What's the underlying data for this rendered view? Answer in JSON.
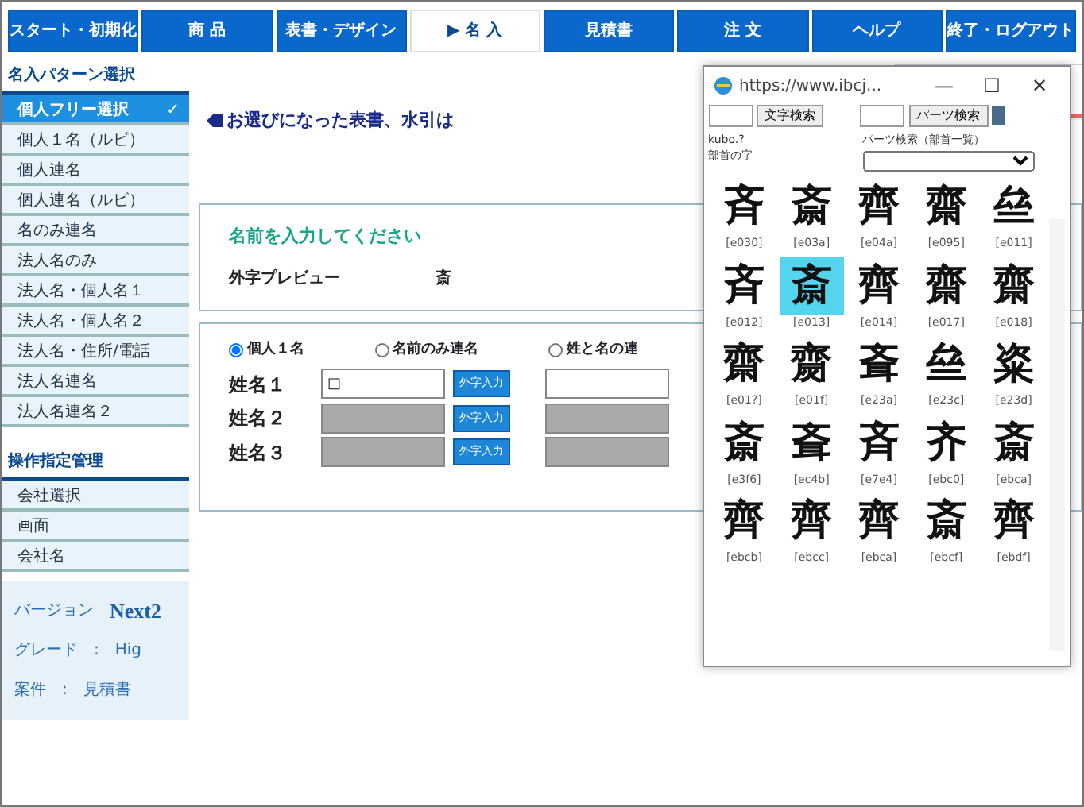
{
  "nav": [
    {
      "label": "スタート・初期化",
      "selected": false
    },
    {
      "label": "商 品",
      "selected": false
    },
    {
      "label": "表書・デザイン",
      "selected": false
    },
    {
      "label": "▶ 名 入",
      "selected": true
    },
    {
      "label": "見積書",
      "selected": false
    },
    {
      "label": "注 文",
      "selected": false
    },
    {
      "label": "ヘルプ",
      "selected": false
    },
    {
      "label": "終了・ログアウト",
      "selected": false
    }
  ],
  "sidebar": {
    "title": "名入パターン選択",
    "items": [
      {
        "label": "個人フリー選択",
        "selected": true,
        "check": "✓"
      },
      {
        "label": "個人１名（ルビ）",
        "selected": false
      },
      {
        "label": "個人連名",
        "selected": false
      },
      {
        "label": "個人連名（ルビ）",
        "selected": false
      },
      {
        "label": "名のみ連名",
        "selected": false
      },
      {
        "label": "法人名のみ",
        "selected": false
      },
      {
        "label": "法人名・個人名１",
        "selected": false
      },
      {
        "label": "法人名・個人名２",
        "selected": false
      },
      {
        "label": "法人名・住所/電話",
        "selected": false
      },
      {
        "label": "法人名連名",
        "selected": false
      },
      {
        "label": "法人名連名２",
        "selected": false
      }
    ],
    "section_title": "操作指定管理",
    "section_items": [
      {
        "label": "会社選択"
      },
      {
        "label": "画面"
      },
      {
        "label": "会社名"
      }
    ],
    "info": [
      {
        "label": "バージョン",
        "value": "Next2",
        "kind": "version"
      },
      {
        "label": "グレード",
        "sep": ":",
        "value": "Hig",
        "kind": "plain"
      },
      {
        "label": "案件",
        "sep": ":",
        "value": "見積書",
        "kind": "plain"
      }
    ]
  },
  "selection": {
    "heading": "お選びになった表書、水引は"
  },
  "name_card": {
    "title": "名前を入力してください",
    "preview_label": "外字プレビュー",
    "preview_char": "斎"
  },
  "entry": {
    "modes": [
      {
        "label": "個人１名",
        "selected": true
      },
      {
        "label": "名前のみ連名",
        "selected": false
      },
      {
        "label": "姓と名の連",
        "selected": false
      }
    ],
    "rows": [
      {
        "label": "姓名１",
        "value": "□",
        "disabled": false,
        "button": "外字入力"
      },
      {
        "label": "姓名２",
        "value": "",
        "disabled": true,
        "button": "外字入力"
      },
      {
        "label": "姓名３",
        "value": "",
        "disabled": true,
        "button": "外字入力"
      }
    ]
  },
  "popup": {
    "title": "https://www.ibcj...",
    "controls": [
      "—",
      "☐",
      "✕"
    ],
    "search_button": "文字検索",
    "parts_button": "パーツ検索",
    "status": "kubo.?",
    "radical_label": "部首の字",
    "parts_label": "パーツ検索（部首一覧）",
    "glyphs": [
      {
        "char": "斉",
        "code": "[e030]",
        "selected": false
      },
      {
        "char": "斎",
        "code": "[e03a]",
        "selected": false
      },
      {
        "char": "齊",
        "code": "[e04a]",
        "selected": false
      },
      {
        "char": "齋",
        "code": "[e095]",
        "selected": false
      },
      {
        "char": "亝",
        "code": "[e011]",
        "selected": false
      },
      {
        "char": "斉",
        "code": "[e012]",
        "selected": false
      },
      {
        "char": "斎",
        "code": "[e013]",
        "selected": true
      },
      {
        "char": "齊",
        "code": "[e014]",
        "selected": false
      },
      {
        "char": "齋",
        "code": "[e017]",
        "selected": false
      },
      {
        "char": "齋",
        "code": "[e018]",
        "selected": false
      },
      {
        "char": "齋",
        "code": "[e01?]",
        "selected": false
      },
      {
        "char": "齌",
        "code": "[e01f]",
        "selected": false
      },
      {
        "char": "斊",
        "code": "[e23a]",
        "selected": false
      },
      {
        "char": "亝",
        "code": "[e23c]",
        "selected": false
      },
      {
        "char": "粢",
        "code": "[e23d]",
        "selected": false
      },
      {
        "char": "斎",
        "code": "[e3f6]",
        "selected": false
      },
      {
        "char": "斊",
        "code": "[ec4b]",
        "selected": false
      },
      {
        "char": "斉",
        "code": "[e7e4]",
        "selected": false
      },
      {
        "char": "齐",
        "code": "[ebc0]",
        "selected": false
      },
      {
        "char": "斎",
        "code": "[ebca]",
        "selected": false
      },
      {
        "char": "齊",
        "code": "[ebcb]",
        "selected": false
      },
      {
        "char": "齊",
        "code": "[ebcc]",
        "selected": false
      },
      {
        "char": "齊",
        "code": "[ebca]",
        "selected": false
      },
      {
        "char": "斎",
        "code": "[ebcf]",
        "selected": false
      },
      {
        "char": "齊",
        "code": "[ebdf]",
        "selected": false
      }
    ]
  }
}
